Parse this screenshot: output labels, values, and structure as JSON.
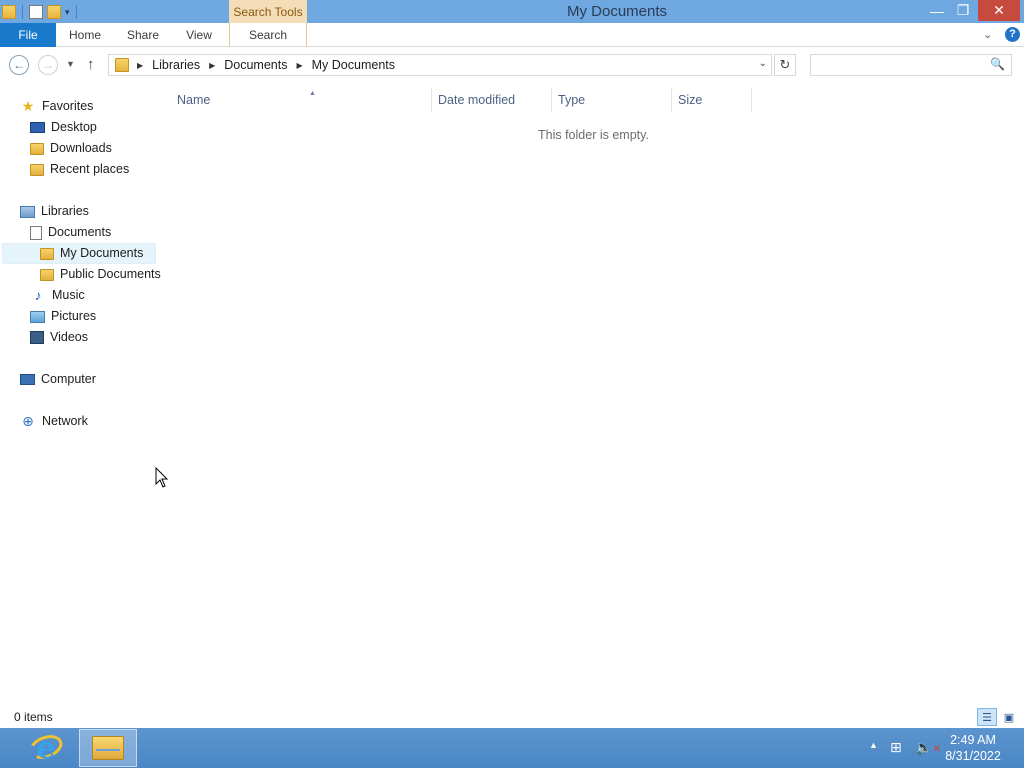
{
  "window": {
    "title": "My Documents",
    "contextual_tab": "Search Tools",
    "minimize_glyph": "—",
    "maximize_glyph": "❐",
    "close_glyph": "✕"
  },
  "ribbon": {
    "tabs": [
      "File",
      "Home",
      "Share",
      "View",
      "Search"
    ],
    "expand_glyph": "⌄",
    "help_glyph": "?"
  },
  "navigation": {
    "back_glyph": "←",
    "forward_glyph": "→",
    "recent_glyph": "▼",
    "up_glyph": "↑",
    "breadcrumb": [
      "Libraries",
      "Documents",
      "My Documents"
    ],
    "crumb_sep": "▶",
    "dropdown_glyph": "⌄",
    "refresh_glyph": "↻",
    "search_placeholder": "",
    "search_glyph": "🔍"
  },
  "sidebar": {
    "favorites": {
      "label": "Favorites",
      "items": [
        "Desktop",
        "Downloads",
        "Recent places"
      ]
    },
    "libraries": {
      "label": "Libraries",
      "documents": "Documents",
      "documents_children": [
        "My Documents",
        "Public Documents"
      ],
      "items": [
        "Music",
        "Pictures",
        "Videos"
      ]
    },
    "computer": "Computer",
    "network": "Network",
    "selected": "My Documents"
  },
  "content": {
    "columns": [
      "Name",
      "Date modified",
      "Type",
      "Size"
    ],
    "sort_glyph": "▲",
    "empty_message": "This folder is empty."
  },
  "status": {
    "item_count": "0 items"
  },
  "taskbar": {
    "tray_chevron": "▲",
    "time": "2:49 AM",
    "date": "8/31/2022"
  },
  "icons": {
    "ie": "internet-explorer-icon",
    "explorer": "file-explorer-icon",
    "favorites": "star-icon"
  },
  "colors": {
    "titlebar": "#6fa7e0",
    "file_tab": "#1979ca",
    "close_button": "#c74a3e",
    "search_tools": "#f5ddb8",
    "taskbar": "#4a86c6"
  }
}
